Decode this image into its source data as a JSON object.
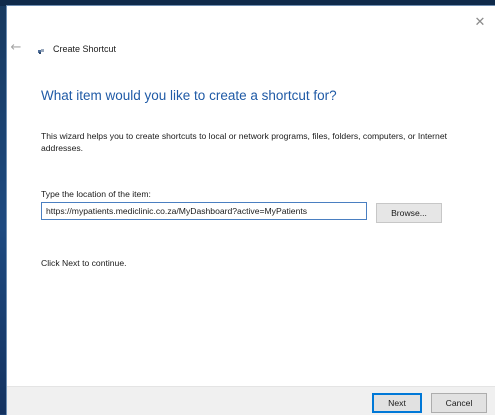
{
  "window": {
    "title": "Create Shortcut",
    "close_glyph": "✕",
    "back_glyph": "←"
  },
  "icons": {
    "back": "back-arrow-icon",
    "close": "close-icon",
    "wizard": "shortcut-wizard-icon"
  },
  "content": {
    "heading": "What item would you like to create a shortcut for?",
    "description": "This wizard helps you to create shortcuts to local or network programs, files, folders, computers, or Internet addresses.",
    "location_label": "Type the location of the item:",
    "location_value": "https://mypatients.mediclinic.co.za/MyDashboard?active=MyPatients",
    "browse_label": "Browse...",
    "continue_text": "Click Next to continue."
  },
  "footer": {
    "next_label": "Next",
    "cancel_label": "Cancel"
  },
  "colors": {
    "heading": "#1f5aa6",
    "accent": "#0078d7",
    "desktop": "#1b3f72"
  }
}
